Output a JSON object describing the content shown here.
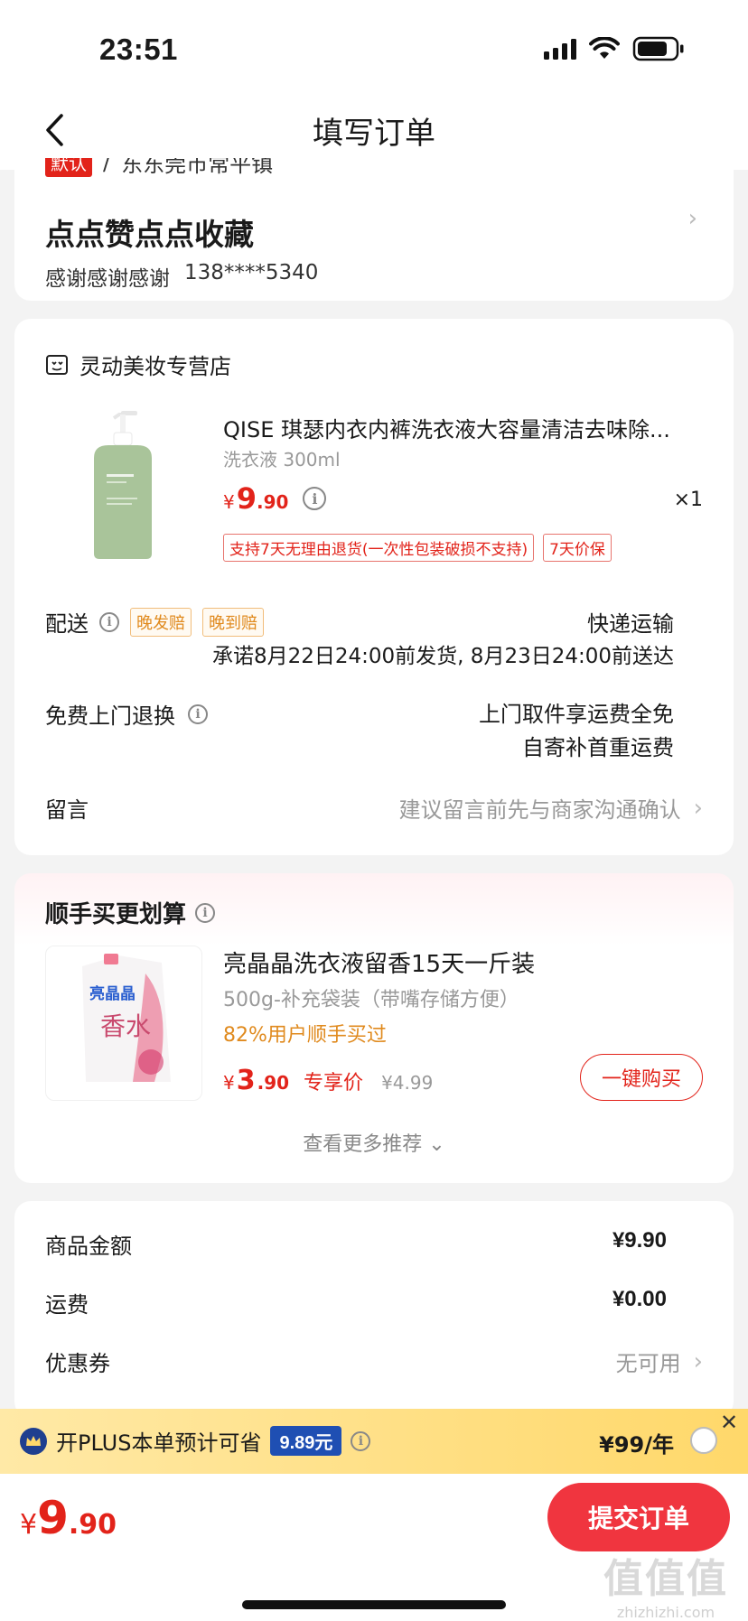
{
  "status": {
    "time": "23:51"
  },
  "nav": {
    "title": "填写订单"
  },
  "address": {
    "default_tag": "默认",
    "separator": "/",
    "region": "东东莞市常平镇",
    "name": "点点赞点点收藏",
    "receiver": "感谢感谢感谢",
    "phone": "138****5340"
  },
  "order": {
    "store_name": "灵动美妆专营店",
    "product": {
      "title": "QISE 琪瑟内衣内裤洗衣液大容量清洁去味除...",
      "spec": "洗衣液 300ml",
      "price_yen": "¥",
      "price_int": "9",
      "price_dec": ".90",
      "qty": "×1",
      "tags": [
        "支持7天无理由退货(一次性包装破损不支持)",
        "7天价保"
      ]
    },
    "delivery": {
      "label": "配送",
      "tags": [
        "晚发赔",
        "晚到赔"
      ],
      "method": "快递运输",
      "promise": "承诺8月22日24:00前发货, 8月23日24:00前送达"
    },
    "returns": {
      "label": "免费上门退换",
      "line1": "上门取件享运费全免",
      "line2": "自寄补首重运费"
    },
    "message": {
      "label": "留言",
      "hint": "建议留言前先与商家沟通确认"
    }
  },
  "recommend": {
    "title": "顺手买更划算",
    "name": "亮晶晶洗衣液留香15天一斤装",
    "spec": "500g-补充袋装（带嘴存储方便）",
    "bought": "82%用户顺手买过",
    "price_yen": "¥",
    "price_int": "3",
    "price_dec": ".90",
    "exclusive": "专享价",
    "orig_price": "¥4.99",
    "buy_label": "一键购买",
    "more": "查看更多推荐 ⌄",
    "img_brand": "亮晶晶",
    "img_text": "香水"
  },
  "summary": {
    "goods_label": "商品金额",
    "goods_value": "¥9.90",
    "shipping_label": "运费",
    "shipping_value": "¥0.00",
    "coupon_label": "优惠券",
    "coupon_value": "无可用"
  },
  "plus": {
    "text": "开PLUS本单预计可省",
    "save": "9.89元",
    "price": "¥99/年"
  },
  "footer": {
    "total_yen": "¥",
    "total_int": "9",
    "total_dec": ".90",
    "submit": "提交订单",
    "watermark": "值值值",
    "watermark_url": "zhizhizhi.com"
  },
  "colors": {
    "accent": "#e2231a",
    "submit_bg": "#f0353f",
    "plus_bg": "#ffd86a",
    "plus_tag": "#1f4fb3",
    "orange": "#e08a1e"
  }
}
